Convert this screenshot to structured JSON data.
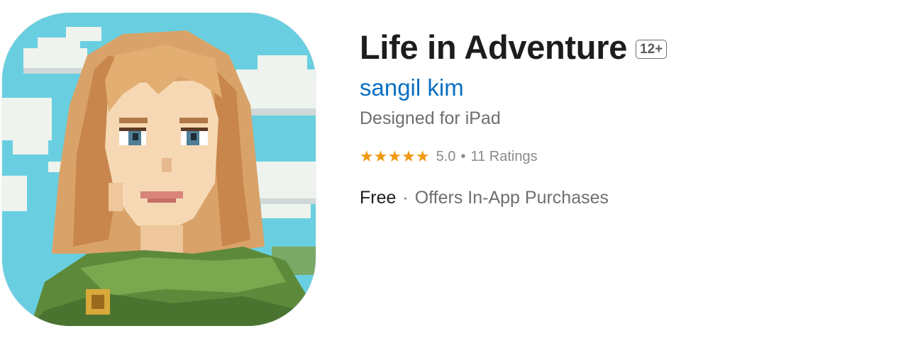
{
  "app": {
    "title": "Life in Adventure",
    "age_rating": "12+",
    "developer": "sangil kim",
    "subtitle": "Designed for iPad",
    "rating": {
      "stars": "★★★★★",
      "value": "5.0",
      "separator": "•",
      "count": "11 Ratings"
    },
    "price": "Free",
    "price_separator": "·",
    "in_app_purchases": "Offers In-App Purchases"
  },
  "colors": {
    "developer_link": "#0a6fc2",
    "stars": "#f0980f",
    "title": "#1d1d1f",
    "secondary_text": "#6e6e73"
  },
  "icon": {
    "name": "app-icon",
    "description_icon": "pixel-art-girl-portrait-icon"
  }
}
